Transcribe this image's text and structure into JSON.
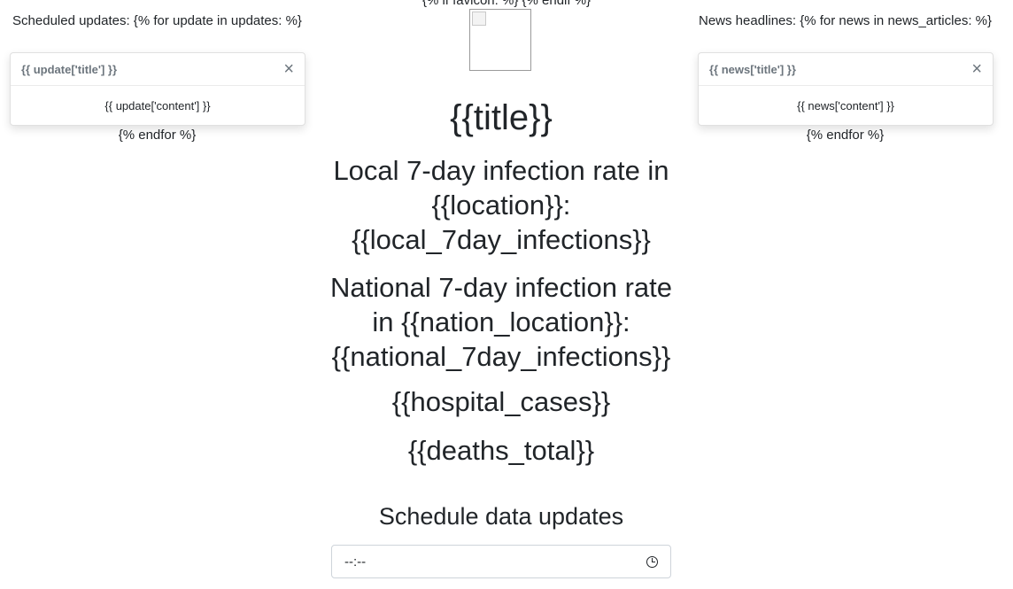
{
  "favicon": {
    "text": "{% if favicon: %} {% endif %}"
  },
  "left_panel": {
    "heading": "Scheduled updates: {% for update in updates: %}",
    "toast_title": "{{ update['title'] }}",
    "toast_body": "{{ update['content'] }}",
    "close_symbol": "×",
    "endfor": "{% endfor %}"
  },
  "right_panel": {
    "heading": "News headlines: {% for news in news_articles: %}",
    "toast_title": "{{ news['title'] }}",
    "toast_body": "{{ news['content'] }}",
    "close_symbol": "×",
    "endfor": "{% endfor %}"
  },
  "main": {
    "title": "{{title}}",
    "local_rate": "Local 7-day infection rate in {{location}}: {{local_7day_infections}}",
    "national_rate": "National 7-day infection rate in {{nation_location}}: {{national_7day_infections}}",
    "hospital_cases": "{{hospital_cases}}",
    "deaths_total": "{{deaths_total}}",
    "schedule_heading": "Schedule data updates",
    "time_input_value": "--:--"
  },
  "icons": {
    "clock": "clock-icon",
    "close": "close-icon"
  }
}
